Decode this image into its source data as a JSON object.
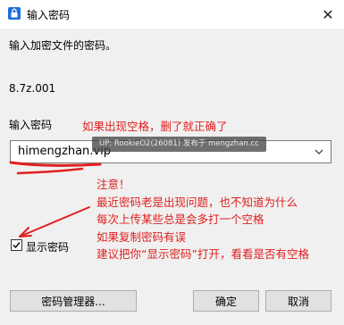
{
  "window": {
    "title": "输入密码",
    "close_symbol": "✕"
  },
  "dialog": {
    "prompt": "输入加密文件的密码。",
    "filename": "8.7z.001",
    "password_label": "输入密码",
    "password_value": "himengzhan.vip",
    "show_password_label": "显示密码",
    "show_password_checked": true
  },
  "buttons": {
    "manager": "密码管理器...",
    "ok": "确定",
    "cancel": "取消"
  },
  "overlay": {
    "watermark": "UP: RookieO2(26081) 发布于 mengzhan.cc",
    "annotation_top": "如果出现空格，删了就正确了",
    "annotation_lines": [
      "注意！",
      "最近密码老是出现问题，也不知道为什么",
      "每次上传某些总是会多打一个空格",
      "如果复制密码有误",
      "建议把你“显示密码”打开，看看是否有空格"
    ],
    "annotation_color": "#e02020"
  },
  "icons": {
    "app": "lock-app-icon",
    "close": "close-icon",
    "dropdown": "chevron-down-icon",
    "check": "checkmark-icon"
  }
}
